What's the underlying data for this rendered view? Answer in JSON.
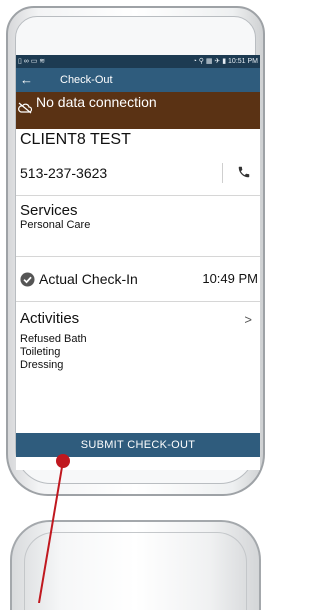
{
  "status_bar": {
    "left_icons": "▯ ∞ ▭ ≋",
    "right_icons": "◔ ⚲ ▦ ✈ ▮",
    "time": "10:51 PM"
  },
  "app_bar": {
    "back_icon": "arrow-left-icon",
    "title": "Check-Out"
  },
  "banner": {
    "icon": "cloud-off-icon",
    "text": "No data connection",
    "color": "#5a3214"
  },
  "client": {
    "name": "CLIENT8 TEST",
    "phone": "513-237-3623",
    "phone_icon": "phone-icon"
  },
  "services": {
    "title": "Services",
    "value": "Personal Care"
  },
  "checkin": {
    "icon": "check-circle-icon",
    "label": "Actual Check-In",
    "time": "10:49 PM"
  },
  "activities": {
    "title": "Activities",
    "chevron": ">",
    "items": [
      "Refused Bath",
      "Toileting",
      "Dressing"
    ]
  },
  "submit": {
    "label": "SUBMIT CHECK-OUT",
    "color": "#2f5c7d"
  },
  "annotation_color": "#c0181f"
}
